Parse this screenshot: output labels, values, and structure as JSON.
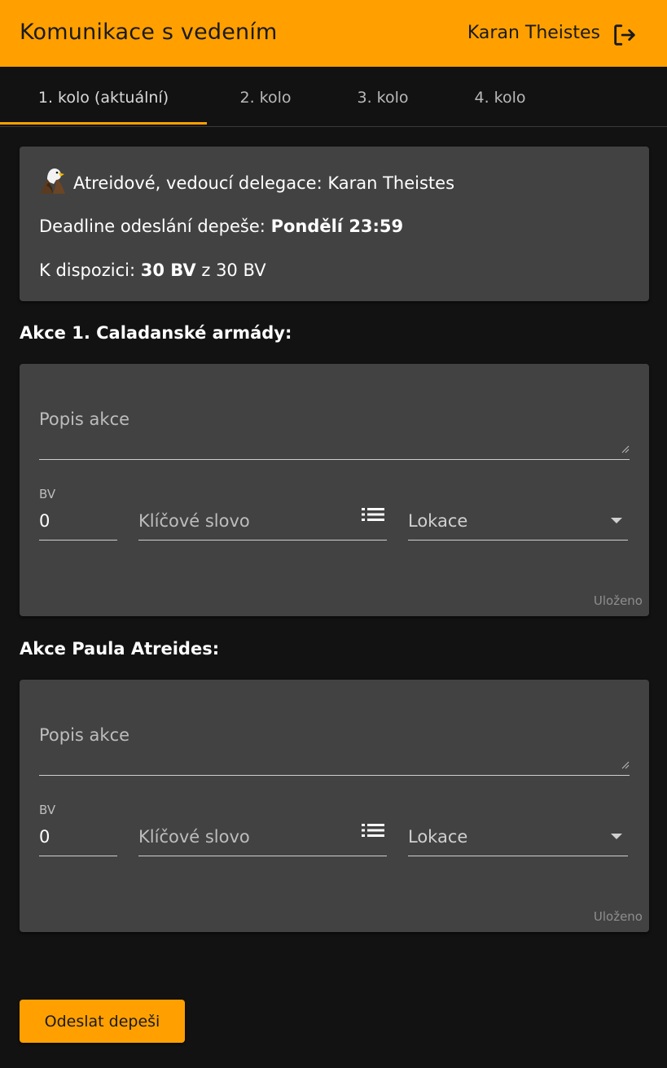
{
  "header": {
    "title": "Komunikace s vedením",
    "user_name": "Karan Theistes",
    "logout_icon": "logout-icon"
  },
  "tabs": [
    {
      "label": "1. kolo (aktuální)",
      "active": true
    },
    {
      "label": "2. kolo",
      "active": false
    },
    {
      "label": "3. kolo",
      "active": false
    },
    {
      "label": "4. kolo",
      "active": false
    }
  ],
  "info": {
    "faction_icon": "eagle-icon",
    "delegation": "Atreidové, vedoucí delegace: Karan Theistes",
    "deadline_label": "Deadline odeslání depeše:",
    "deadline_value": "Pondělí 23:59",
    "available_label": "K dispozici:",
    "available_value": "30 BV",
    "available_total": "z 30 BV"
  },
  "actions": [
    {
      "title": "Akce 1. Caladanské armády:",
      "description_placeholder": "Popis akce",
      "bv_label": "BV",
      "bv_value": "0",
      "keyword_placeholder": "Klíčové slovo",
      "location_placeholder": "Lokace",
      "status": "Uloženo"
    },
    {
      "title": "Akce Paula Atreides:",
      "description_placeholder": "Popis akce",
      "bv_label": "BV",
      "bv_value": "0",
      "keyword_placeholder": "Klíčové slovo",
      "location_placeholder": "Lokace",
      "status": "Uloženo"
    }
  ],
  "submit_label": "Odeslat depeši",
  "colors": {
    "accent": "#ffa000",
    "background": "#121212",
    "card": "#424242"
  }
}
